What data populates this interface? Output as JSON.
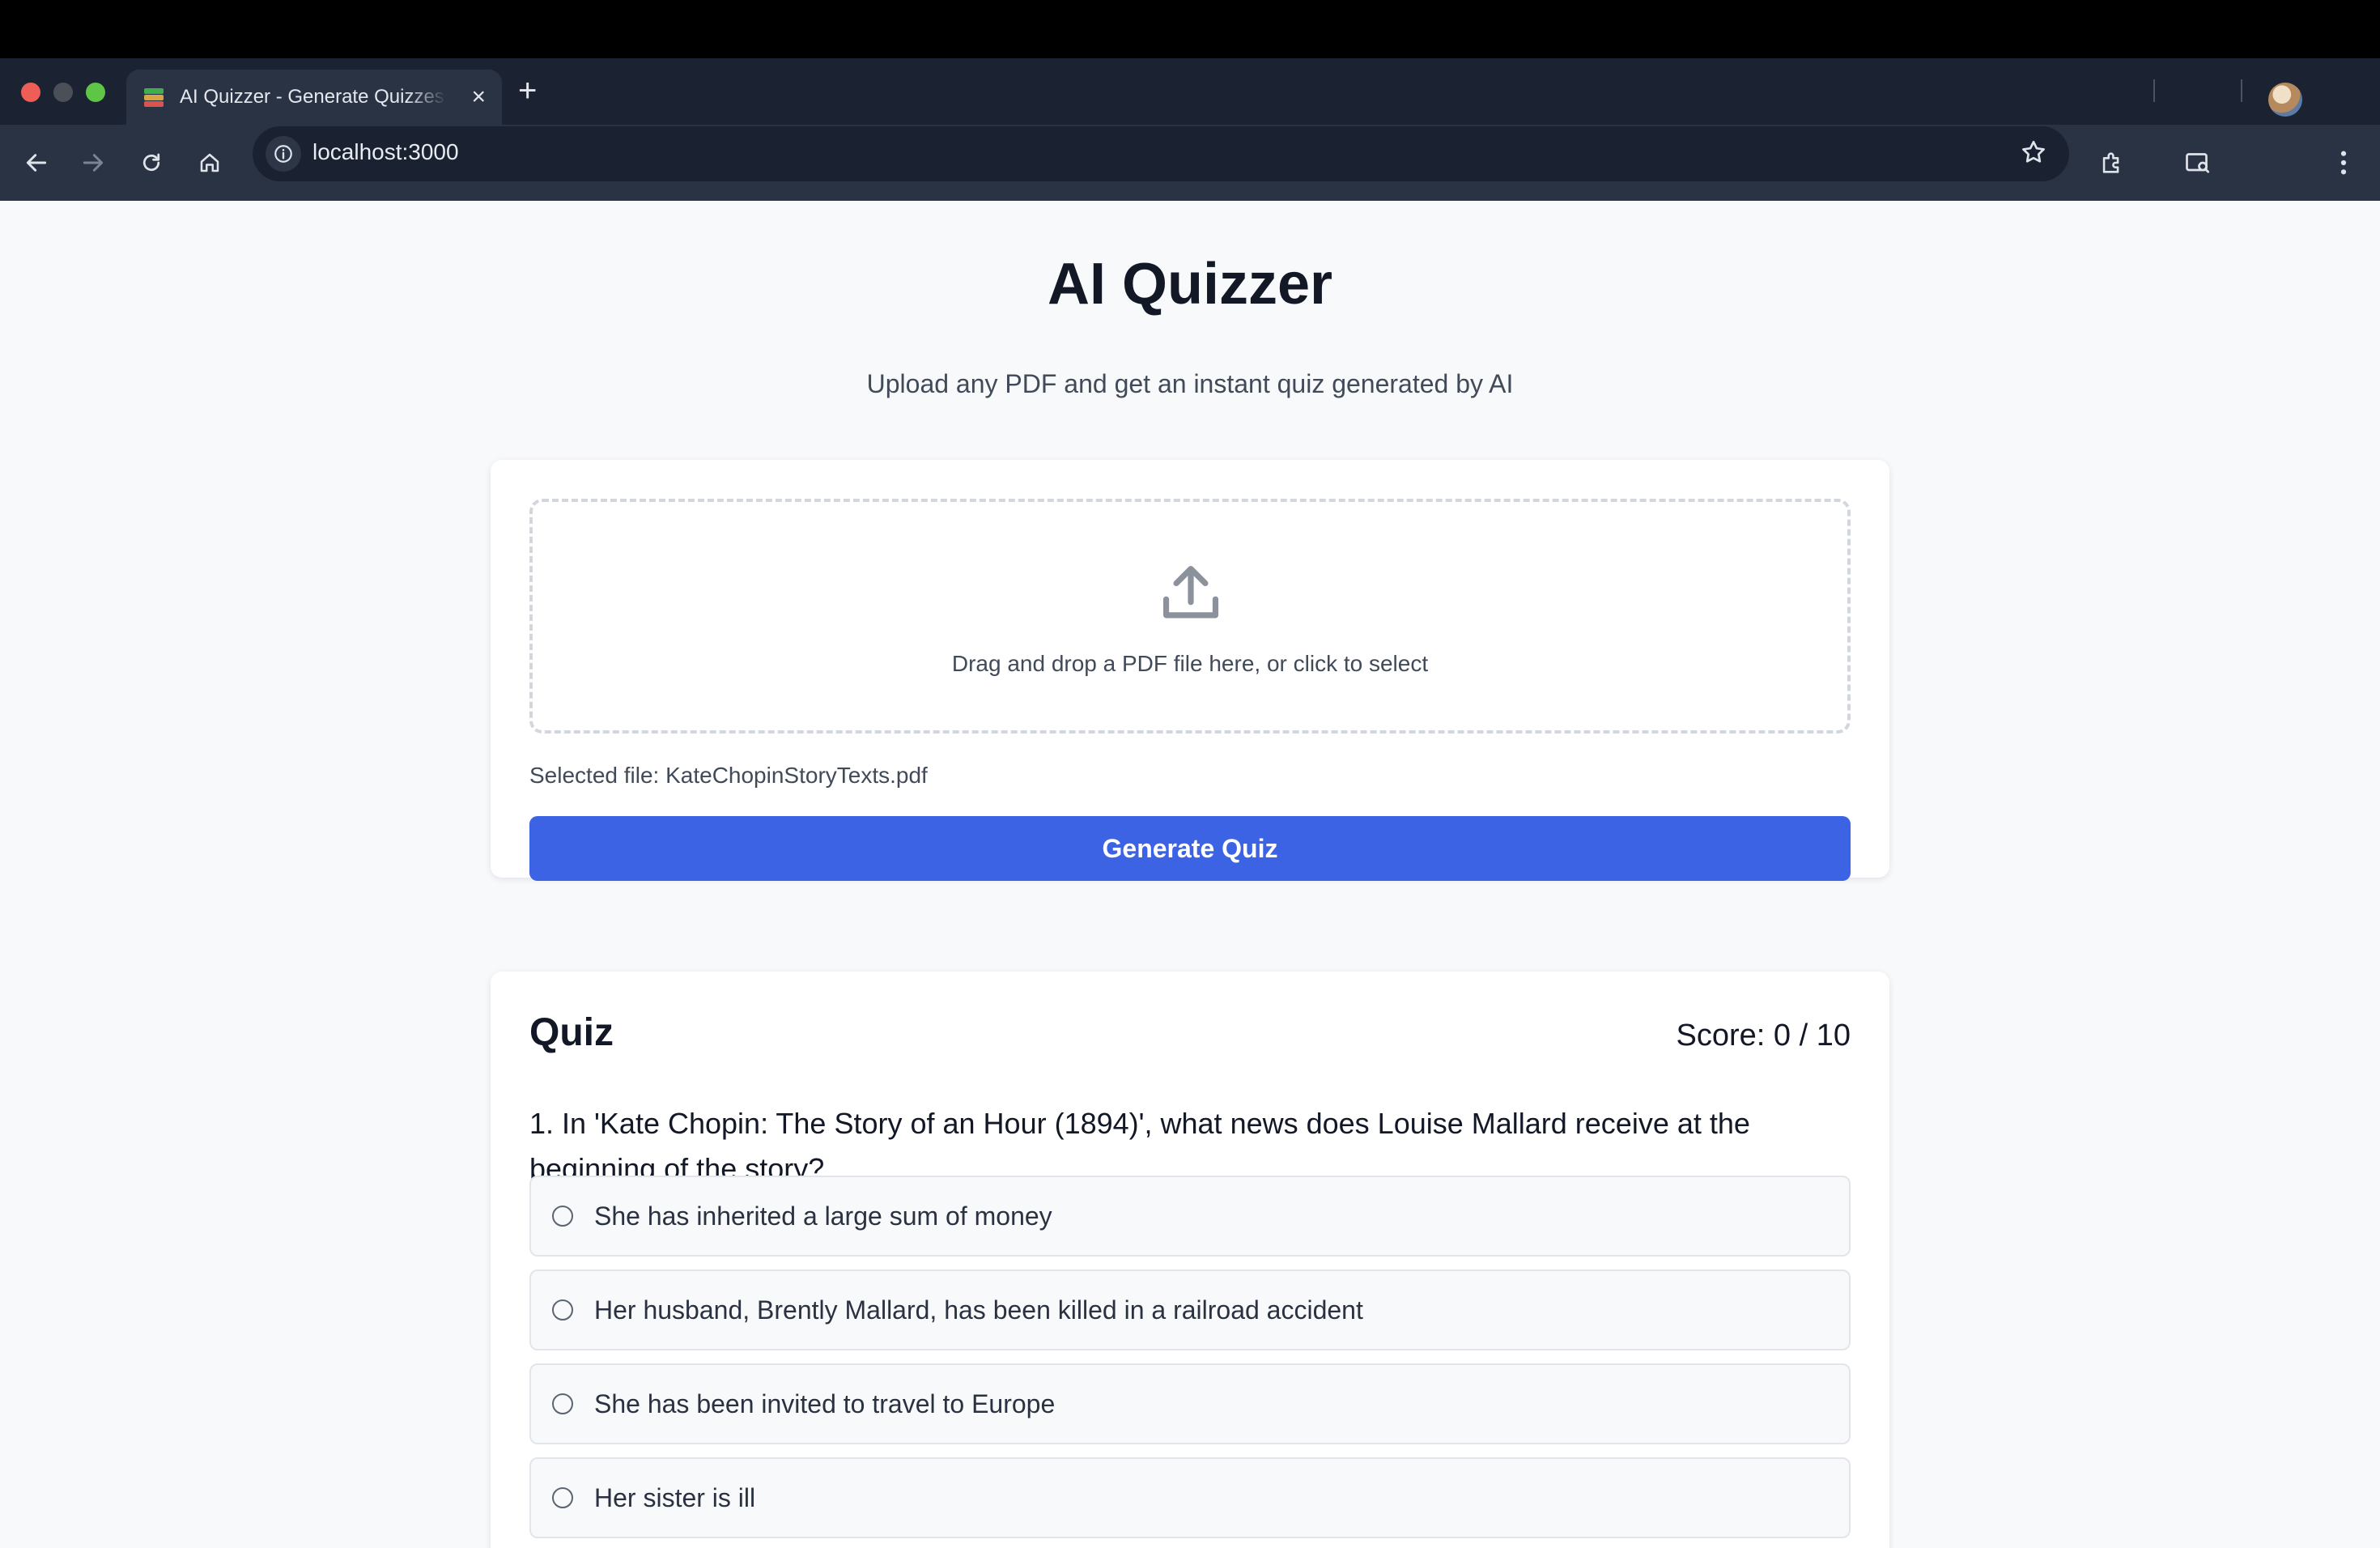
{
  "browser": {
    "tab_title": "AI Quizzer - Generate Quizzes",
    "url": "localhost:3000"
  },
  "page": {
    "title": "AI Quizzer",
    "subtitle": "Upload any PDF and get an instant quiz generated by AI"
  },
  "upload": {
    "dropzone_text": "Drag and drop a PDF file here, or click to select",
    "selected_file": "Selected file: KateChopinStoryTexts.pdf",
    "generate_label": "Generate Quiz"
  },
  "quiz": {
    "title": "Quiz",
    "score": "Score: 0 / 10",
    "question": "1. In 'Kate Chopin: The Story of an Hour (1894)', what news does Louise Mallard receive at the beginning of the story?",
    "options": [
      "She has inherited a large sum of money",
      "Her husband, Brently Mallard, has been killed in a railroad accident",
      "She has been invited to travel to Europe",
      "Her sister is ill"
    ]
  },
  "colors": {
    "accent": "#3b63e3",
    "page_bg": "#f8f9fb",
    "browser_chrome": "#2a3344"
  }
}
